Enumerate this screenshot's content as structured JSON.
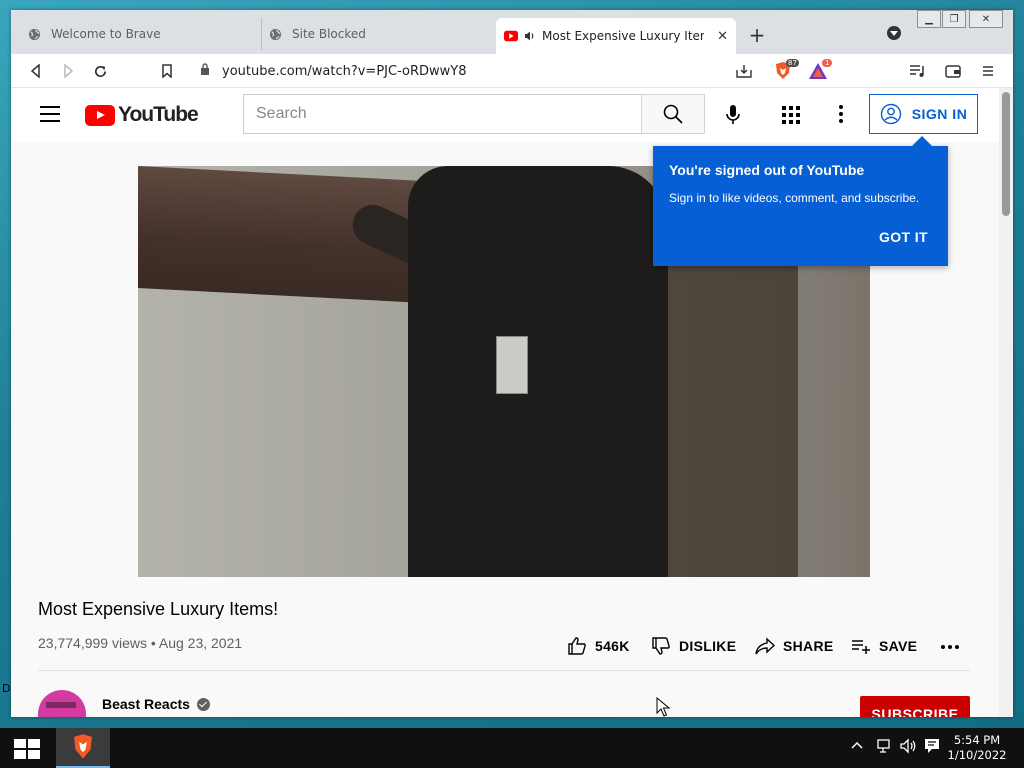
{
  "browser": {
    "tabs": [
      {
        "label": "Welcome to Brave"
      },
      {
        "label": "Site Blocked"
      },
      {
        "label": "Most Expensive Luxury Items!"
      }
    ],
    "url": "youtube.com/watch?v=PJC-oRDwwY8",
    "shield_count": "87",
    "rewards_count": "1"
  },
  "youtube": {
    "logo_text": "YouTube",
    "search_placeholder": "Search",
    "sign_in_label": "SIGN IN",
    "tooltip": {
      "title": "You're signed out of YouTube",
      "body": "Sign in to like videos, comment, and subscribe.",
      "button": "GOT IT"
    },
    "video": {
      "title": "Most Expensive Luxury Items!",
      "meta": "23,774,999 views • Aug 23, 2021",
      "likes": "546K",
      "dislike_label": "DISLIKE",
      "share_label": "SHARE",
      "save_label": "SAVE"
    },
    "channel": {
      "name": "Beast Reacts",
      "subscribe_label": "SUBSCRIBE"
    }
  },
  "desktop": {
    "edge_text": "D"
  },
  "taskbar": {
    "time": "5:54 PM",
    "date": "1/10/2022"
  },
  "colors": {
    "youtube_red": "#ff0000",
    "sign_in_blue": "#065fd4",
    "subscribe_red": "#cc0000"
  }
}
